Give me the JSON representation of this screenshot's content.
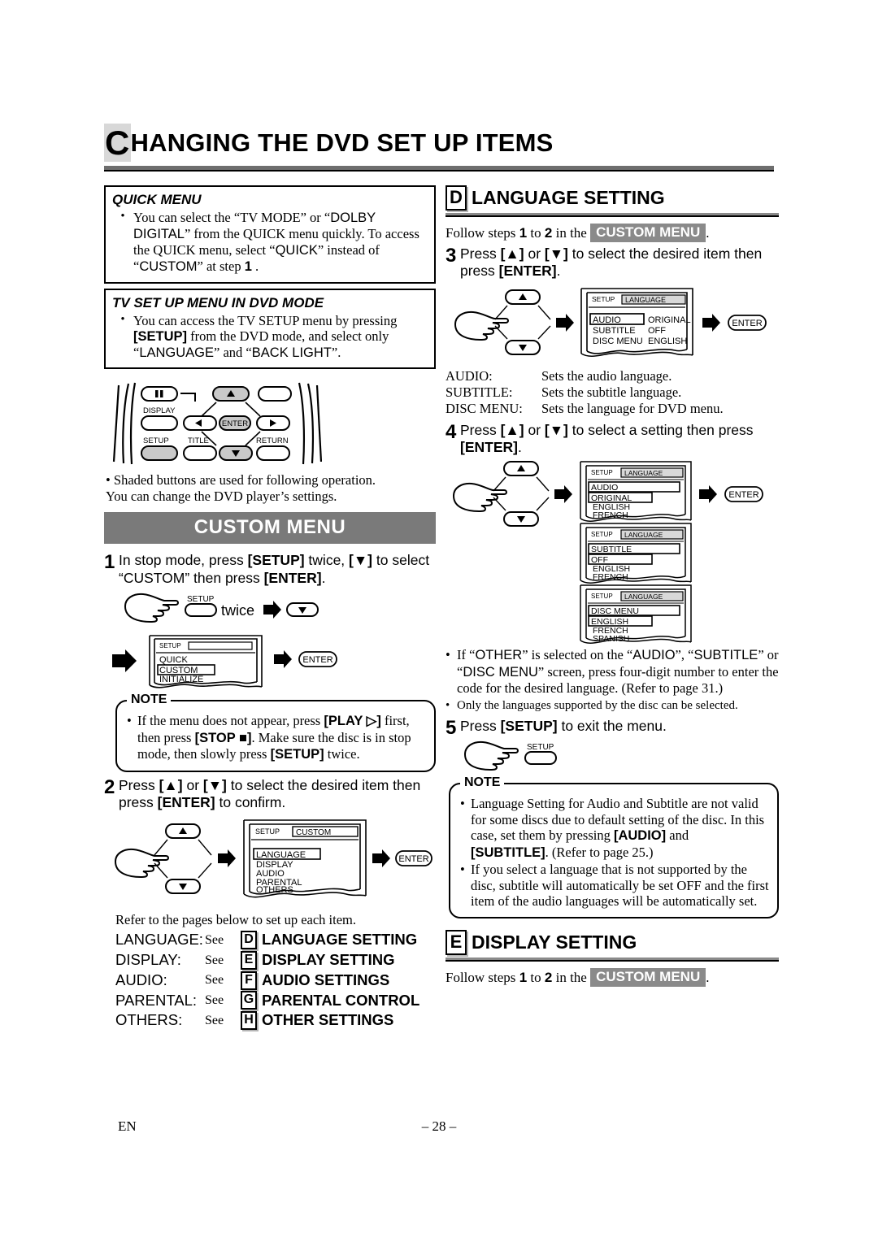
{
  "page": {
    "title_dropcap": "C",
    "title_rest": "HANGING THE DVD SET UP ITEMS",
    "footer_left": "EN",
    "footer_page": "– 28 –"
  },
  "quick_menu": {
    "heading": "QUICK MENU",
    "bullet": "You can select the “TV MODE” or “DOLBY DIGITAL” from the QUICK menu quickly. To access the QUICK menu, select “QUICK” instead of “CUSTOM” at step 1 ."
  },
  "tv_setup_menu": {
    "heading": "TV SET UP MENU IN DVD MODE",
    "bullet": "You can access the TV SETUP menu by pressing [SETUP] from the DVD mode, and select only “LANGUAGE” and “BACK LIGHT”."
  },
  "remote": {
    "labels": {
      "display": "DISPLAY",
      "setup": "SETUP",
      "title": "TITLE",
      "return": "RETURN",
      "enter": "ENTER",
      "pause": "❚❚",
      "up": "▲",
      "down": "▼",
      "left": "◀",
      "right": "▶"
    }
  },
  "shaded_note": {
    "line1": "• Shaded buttons are used for following operation.",
    "line2": "You can change the DVD player’s settings."
  },
  "custom_menu": {
    "banner": "CUSTOM MENU",
    "step1": {
      "num": "1",
      "text": "In stop mode, press [SETUP] twice, [▼] to select “CUSTOM” then press [ENTER]."
    },
    "step1_diagram": {
      "setup_label": "SETUP",
      "twice_label": "twice",
      "down_label": "▼",
      "enter_label": "ENTER"
    },
    "step1_screen": {
      "title_left": "SETUP",
      "title_right": "",
      "items": [
        "QUICK",
        "CUSTOM",
        "INITIALIZE"
      ],
      "highlight": "CUSTOM"
    },
    "note": {
      "label": "NOTE",
      "bullet": "If the menu does not appear, press [PLAY ▷] first, then press [STOP ■]. Make sure the disc is in stop mode, then slowly press [SETUP] twice."
    },
    "step2": {
      "num": "2",
      "text": "Press [▲] or [▼] to select the desired item then press [ENTER] to confirm."
    },
    "step2_screen": {
      "title_left": "SETUP",
      "title_right": "CUSTOM",
      "items": [
        "LANGUAGE",
        "DISPLAY",
        "AUDIO",
        "PARENTAL",
        "OTHERS"
      ],
      "highlight": "LANGUAGE"
    },
    "refer_line": "Refer to the pages below to set up each item.",
    "refer_items": [
      {
        "key": "LANGUAGE:",
        "see": "See",
        "letter": "D",
        "value": "LANGUAGE SETTING"
      },
      {
        "key": "DISPLAY:",
        "see": "See",
        "letter": "E",
        "value": "DISPLAY SETTING"
      },
      {
        "key": "AUDIO:",
        "see": "See",
        "letter": "F",
        "value": "AUDIO SETTINGS"
      },
      {
        "key": "PARENTAL:",
        "see": "See",
        "letter": "G",
        "value": "PARENTAL CONTROL"
      },
      {
        "key": "OTHERS:",
        "see": "See",
        "letter": "H",
        "value": "OTHER SETTINGS"
      }
    ]
  },
  "language_setting": {
    "letter": "D",
    "heading": "LANGUAGE SETTING",
    "follow_pre": "Follow steps",
    "follow_n1": "1",
    "follow_mid": "to",
    "follow_n2": "2",
    "follow_post": "in the",
    "chip": "CUSTOM MENU",
    "follow_end": ".",
    "step3": {
      "num": "3",
      "text": "Press [▲] or [▼] to select the desired item then press [ENTER]."
    },
    "step3_screen": {
      "title_left": "SETUP",
      "title_right": "LANGUAGE",
      "rows": [
        {
          "name": "AUDIO",
          "value": "ORIGINAL"
        },
        {
          "name": "SUBTITLE",
          "value": "OFF"
        },
        {
          "name": "DISC MENU",
          "value": "ENGLISH"
        }
      ],
      "highlight": "AUDIO"
    },
    "descriptions": [
      {
        "key": "AUDIO:",
        "text": "Sets the audio language."
      },
      {
        "key": "SUBTITLE:",
        "text": "Sets the subtitle language."
      },
      {
        "key": "DISC MENU:",
        "text": "Sets the language for DVD menu."
      }
    ],
    "step4": {
      "num": "4",
      "text": "Press [▲] or [▼] to select a setting then press [ENTER]."
    },
    "step4_screens": [
      {
        "title_left": "SETUP",
        "title_right": "LANGUAGE",
        "header": "AUDIO",
        "items": [
          "ORIGINAL",
          "ENGLISH",
          "FRENCH"
        ],
        "highlight": "ORIGINAL"
      },
      {
        "title_left": "SETUP",
        "title_right": "LANGUAGE",
        "header": "SUBTITLE",
        "items": [
          "OFF",
          "ENGLISH",
          "FRENCH"
        ],
        "highlight": "OFF"
      },
      {
        "title_left": "SETUP",
        "title_right": "LANGUAGE",
        "header": "DISC MENU",
        "items": [
          "ENGLISH",
          "FRENCH",
          "SPANISH"
        ],
        "highlight": "ENGLISH"
      }
    ],
    "bullet1": "If “OTHER” is selected on the “AUDIO”, “SUBTITLE” or “DISC MENU” screen, press four-digit number to enter the code for the desired language. (Refer to page 31.)",
    "bullet2": "Only the languages supported by the disc can be selected.",
    "step5": {
      "num": "5",
      "text": "Press [SETUP] to exit the menu.",
      "setup_label": "SETUP"
    },
    "note": {
      "label": "NOTE",
      "bullet1": "Language Setting for Audio and Subtitle are not valid for some discs due to default setting of the disc. In this case, set them by pressing [AUDIO] and [SUBTITLE]. (Refer to page 25.)",
      "bullet2": "If you select a language that is not supported by the disc, subtitle will automatically be set OFF and the first item of the audio languages will be automatically set."
    }
  },
  "display_setting": {
    "letter": "E",
    "heading": "DISPLAY SETTING",
    "follow_pre": "Follow steps",
    "follow_n1": "1",
    "follow_mid": "to",
    "follow_n2": "2",
    "follow_post": "in the",
    "chip": "CUSTOM MENU",
    "follow_end": "."
  },
  "colors": {
    "banner_gray": "#7a7a7a",
    "rule_gray": "#6e6e6e",
    "chip_gray": "#8a8a8a",
    "button_shade": "#c9c9c9"
  }
}
